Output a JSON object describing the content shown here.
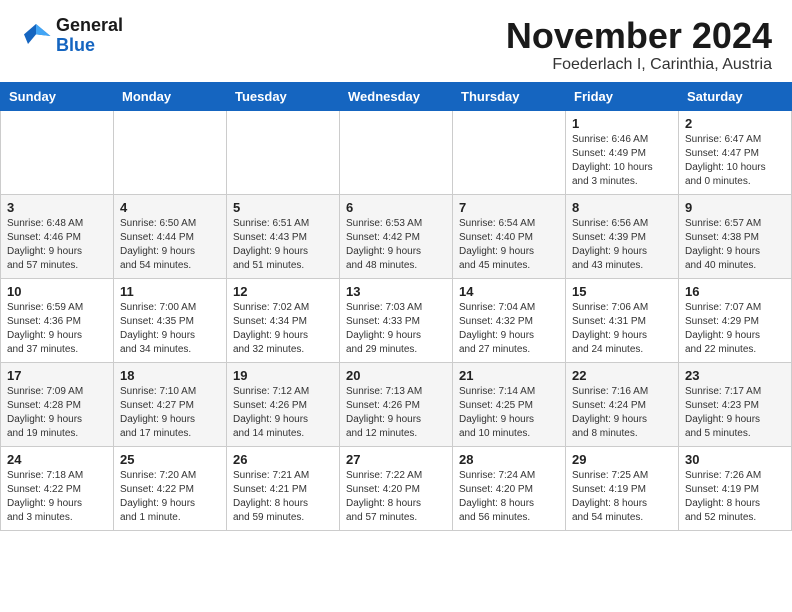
{
  "logo": {
    "line1": "General",
    "line2": "Blue"
  },
  "header": {
    "month": "November 2024",
    "location": "Foederlach I, Carinthia, Austria"
  },
  "weekdays": [
    "Sunday",
    "Monday",
    "Tuesday",
    "Wednesday",
    "Thursday",
    "Friday",
    "Saturday"
  ],
  "weeks": [
    [
      {
        "day": "",
        "info": ""
      },
      {
        "day": "",
        "info": ""
      },
      {
        "day": "",
        "info": ""
      },
      {
        "day": "",
        "info": ""
      },
      {
        "day": "",
        "info": ""
      },
      {
        "day": "1",
        "info": "Sunrise: 6:46 AM\nSunset: 4:49 PM\nDaylight: 10 hours\nand 3 minutes."
      },
      {
        "day": "2",
        "info": "Sunrise: 6:47 AM\nSunset: 4:47 PM\nDaylight: 10 hours\nand 0 minutes."
      }
    ],
    [
      {
        "day": "3",
        "info": "Sunrise: 6:48 AM\nSunset: 4:46 PM\nDaylight: 9 hours\nand 57 minutes."
      },
      {
        "day": "4",
        "info": "Sunrise: 6:50 AM\nSunset: 4:44 PM\nDaylight: 9 hours\nand 54 minutes."
      },
      {
        "day": "5",
        "info": "Sunrise: 6:51 AM\nSunset: 4:43 PM\nDaylight: 9 hours\nand 51 minutes."
      },
      {
        "day": "6",
        "info": "Sunrise: 6:53 AM\nSunset: 4:42 PM\nDaylight: 9 hours\nand 48 minutes."
      },
      {
        "day": "7",
        "info": "Sunrise: 6:54 AM\nSunset: 4:40 PM\nDaylight: 9 hours\nand 45 minutes."
      },
      {
        "day": "8",
        "info": "Sunrise: 6:56 AM\nSunset: 4:39 PM\nDaylight: 9 hours\nand 43 minutes."
      },
      {
        "day": "9",
        "info": "Sunrise: 6:57 AM\nSunset: 4:38 PM\nDaylight: 9 hours\nand 40 minutes."
      }
    ],
    [
      {
        "day": "10",
        "info": "Sunrise: 6:59 AM\nSunset: 4:36 PM\nDaylight: 9 hours\nand 37 minutes."
      },
      {
        "day": "11",
        "info": "Sunrise: 7:00 AM\nSunset: 4:35 PM\nDaylight: 9 hours\nand 34 minutes."
      },
      {
        "day": "12",
        "info": "Sunrise: 7:02 AM\nSunset: 4:34 PM\nDaylight: 9 hours\nand 32 minutes."
      },
      {
        "day": "13",
        "info": "Sunrise: 7:03 AM\nSunset: 4:33 PM\nDaylight: 9 hours\nand 29 minutes."
      },
      {
        "day": "14",
        "info": "Sunrise: 7:04 AM\nSunset: 4:32 PM\nDaylight: 9 hours\nand 27 minutes."
      },
      {
        "day": "15",
        "info": "Sunrise: 7:06 AM\nSunset: 4:31 PM\nDaylight: 9 hours\nand 24 minutes."
      },
      {
        "day": "16",
        "info": "Sunrise: 7:07 AM\nSunset: 4:29 PM\nDaylight: 9 hours\nand 22 minutes."
      }
    ],
    [
      {
        "day": "17",
        "info": "Sunrise: 7:09 AM\nSunset: 4:28 PM\nDaylight: 9 hours\nand 19 minutes."
      },
      {
        "day": "18",
        "info": "Sunrise: 7:10 AM\nSunset: 4:27 PM\nDaylight: 9 hours\nand 17 minutes."
      },
      {
        "day": "19",
        "info": "Sunrise: 7:12 AM\nSunset: 4:26 PM\nDaylight: 9 hours\nand 14 minutes."
      },
      {
        "day": "20",
        "info": "Sunrise: 7:13 AM\nSunset: 4:26 PM\nDaylight: 9 hours\nand 12 minutes."
      },
      {
        "day": "21",
        "info": "Sunrise: 7:14 AM\nSunset: 4:25 PM\nDaylight: 9 hours\nand 10 minutes."
      },
      {
        "day": "22",
        "info": "Sunrise: 7:16 AM\nSunset: 4:24 PM\nDaylight: 9 hours\nand 8 minutes."
      },
      {
        "day": "23",
        "info": "Sunrise: 7:17 AM\nSunset: 4:23 PM\nDaylight: 9 hours\nand 5 minutes."
      }
    ],
    [
      {
        "day": "24",
        "info": "Sunrise: 7:18 AM\nSunset: 4:22 PM\nDaylight: 9 hours\nand 3 minutes."
      },
      {
        "day": "25",
        "info": "Sunrise: 7:20 AM\nSunset: 4:22 PM\nDaylight: 9 hours\nand 1 minute."
      },
      {
        "day": "26",
        "info": "Sunrise: 7:21 AM\nSunset: 4:21 PM\nDaylight: 8 hours\nand 59 minutes."
      },
      {
        "day": "27",
        "info": "Sunrise: 7:22 AM\nSunset: 4:20 PM\nDaylight: 8 hours\nand 57 minutes."
      },
      {
        "day": "28",
        "info": "Sunrise: 7:24 AM\nSunset: 4:20 PM\nDaylight: 8 hours\nand 56 minutes."
      },
      {
        "day": "29",
        "info": "Sunrise: 7:25 AM\nSunset: 4:19 PM\nDaylight: 8 hours\nand 54 minutes."
      },
      {
        "day": "30",
        "info": "Sunrise: 7:26 AM\nSunset: 4:19 PM\nDaylight: 8 hours\nand 52 minutes."
      }
    ]
  ]
}
